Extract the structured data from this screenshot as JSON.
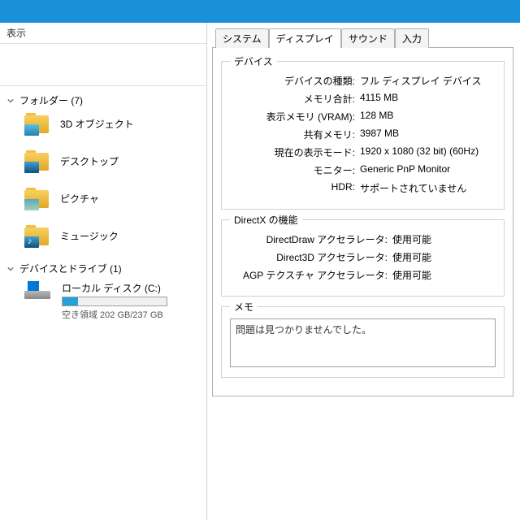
{
  "leftHeader": "表示",
  "folders": {
    "groupLabel": "フォルダー (7)",
    "items": [
      {
        "label": "3D オブジェクト",
        "ov": "ov-3d"
      },
      {
        "label": "デスクトップ",
        "ov": "ov-desk"
      },
      {
        "label": "ピクチャ",
        "ov": "ov-pic"
      },
      {
        "label": "ミュージック",
        "ov": "ov-music"
      }
    ]
  },
  "drives": {
    "groupLabel": "デバイスとドライブ (1)",
    "name": "ローカル ディスク (C:)",
    "free": "空き領域 202 GB/237 GB",
    "fillPct": "15%"
  },
  "tabs": [
    "システム",
    "ディスプレイ",
    "サウンド",
    "入力"
  ],
  "activeTab": 1,
  "device": {
    "title": "デバイス",
    "rows": [
      {
        "k": "デバイスの種類:",
        "v": "フル ディスプレイ デバイス"
      },
      {
        "k": "メモリ合計:",
        "v": "4115 MB"
      },
      {
        "k": "表示メモリ (VRAM):",
        "v": "128 MB"
      },
      {
        "k": "共有メモリ:",
        "v": "3987 MB"
      },
      {
        "k": "現在の表示モード:",
        "v": "1920 x 1080 (32 bit) (60Hz)"
      },
      {
        "k": "モニター:",
        "v": "Generic PnP Monitor"
      },
      {
        "k": "HDR:",
        "v": "サポートされていません"
      }
    ]
  },
  "directx": {
    "title": "DirectX の機能",
    "rows": [
      {
        "k": "DirectDraw アクセラレータ:",
        "v": "使用可能"
      },
      {
        "k": "Direct3D アクセラレータ:",
        "v": "使用可能"
      },
      {
        "k": "AGP テクスチャ アクセラレータ:",
        "v": "使用可能"
      }
    ]
  },
  "memo": {
    "title": "メモ",
    "text": "問題は見つかりませんでした。"
  }
}
